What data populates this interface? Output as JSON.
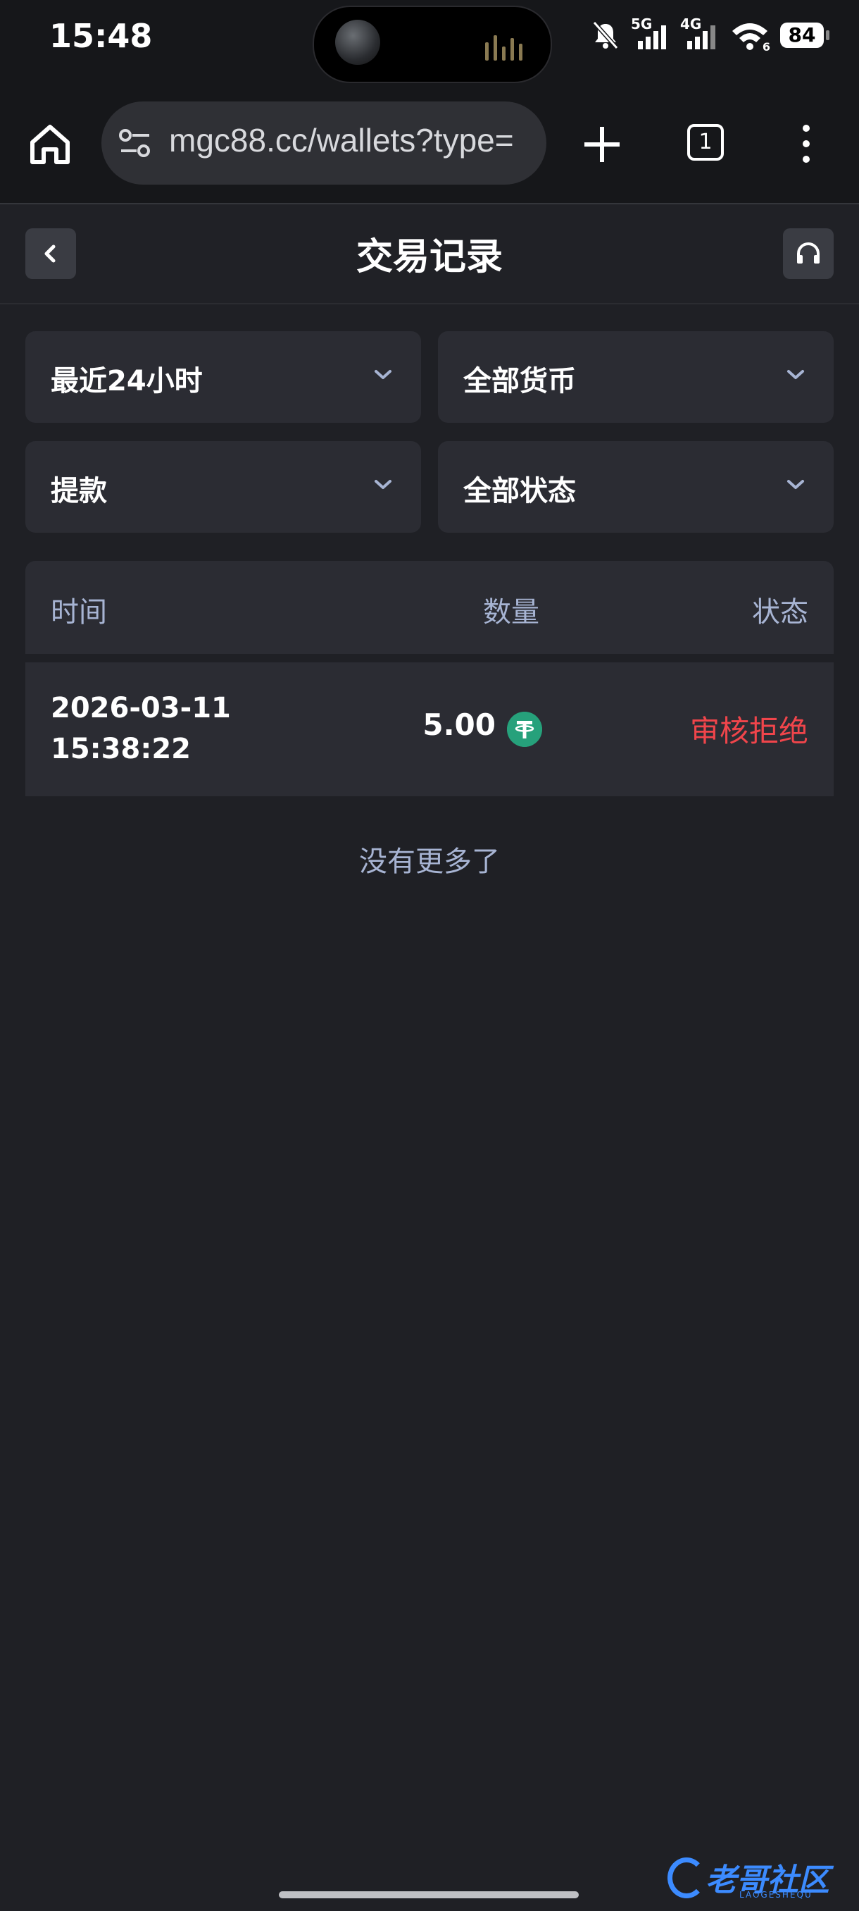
{
  "status_bar": {
    "time": "15:48",
    "network_1": "5G",
    "network_2": "4G",
    "wifi_badge": "6",
    "battery": "84"
  },
  "browser": {
    "url": "mgc88.cc/wallets?type=",
    "tab_count": "1"
  },
  "header": {
    "title": "交易记录"
  },
  "filters": {
    "time_range": "最近24小时",
    "currency": "全部货币",
    "type": "提款",
    "status": "全部状态"
  },
  "table": {
    "columns": [
      "时间",
      "数量",
      "状态"
    ],
    "rows": [
      {
        "date": "2026-03-11",
        "time": "15:38:22",
        "amount": "5.00",
        "currency_icon": "usdt-icon",
        "status": "审核拒绝"
      }
    ]
  },
  "footer_note": "没有更多了",
  "watermark": {
    "text": "老哥社区",
    "sub": "LAOGESHEQU"
  },
  "colors": {
    "background": "#1f2025",
    "card": "#2b2c33",
    "muted_text": "#a7b4d3",
    "rejected": "#f0454b",
    "usdt": "#26a17b"
  }
}
